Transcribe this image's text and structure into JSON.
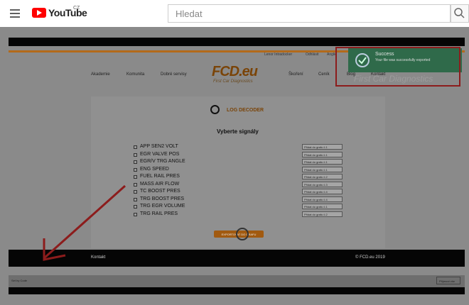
{
  "youtube": {
    "logo_text": "YouTube",
    "country": "CZ",
    "search_placeholder": "Hledat"
  },
  "fcd_site": {
    "user_name": "Lenor Intradocker",
    "logout": "Odhlásit",
    "lang": "Anglie",
    "nav": [
      "Akademie",
      "Komunita",
      "Dobré servisy",
      "Škoření",
      "Ceník",
      "Blog",
      "Kontakt"
    ],
    "logo": "FCD.eu",
    "logo_sub": "First Car Diagnostics",
    "log_decoder_title": "LOG DECODER",
    "select_title": "Vyberte signály",
    "signals": [
      {
        "name": "APP SEN2 VOLT",
        "graph": "Přidat do grafu č.1"
      },
      {
        "name": "EGR VALVE POS",
        "graph": "Přidat do grafu č.1"
      },
      {
        "name": "EGR/V TRG ANGLE",
        "graph": "Přidat do grafu č.1"
      },
      {
        "name": "ENG SPEED",
        "graph": "Přidat do grafu č.1"
      },
      {
        "name": "FUEL RAIL PRES",
        "graph": "Přidat do grafu č.2"
      },
      {
        "name": "MASS AIR FLOW",
        "graph": "Přidat do grafu č.3"
      },
      {
        "name": "TC BOOST PRES",
        "graph": "Přidat do grafu č.4"
      },
      {
        "name": "TRG BOOST PRES",
        "graph": "Přidat do grafu č.4"
      },
      {
        "name": "TRG EGR VOLUME",
        "graph": "Přidat do grafu č.1"
      },
      {
        "name": "TRG RAIL PRES",
        "graph": "Přidat do grafu č.2"
      }
    ],
    "export_button": "EXPORTOVAT DO GRAFU",
    "footer_left": "Kontakt",
    "footer_right": "© FCD.eu 2019",
    "bottom_left": "Set by Code",
    "bottom_right": "Přijmout vše"
  },
  "toast": {
    "title": "Success",
    "message": "Your file was successfully exported",
    "ghost_logo": "FCD.eu",
    "ghost_sub": "First Car Diagnostics"
  },
  "colors": {
    "accent_brown": "#7a4408",
    "annotation_red": "#8c1c1c",
    "toast_green": "#2f6a4a"
  }
}
